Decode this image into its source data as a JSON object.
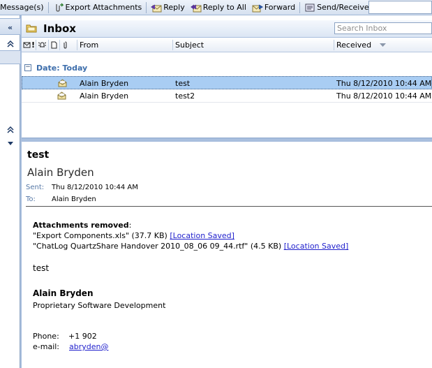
{
  "toolbar": {
    "messages_label": "Message(s)",
    "export_label": "Export Attachments",
    "reply_label": "Reply",
    "reply_all_label": "Reply to All",
    "forward_label": "Forward",
    "send_receive_label": "Send/Receive"
  },
  "rail": {
    "collapse_icon": "double-chevron-left",
    "up_icon_1": "double-chevron-up",
    "up_icon_2": "double-chevron-up",
    "down_icon": "triangle-down"
  },
  "inbox": {
    "title": "Inbox",
    "search_placeholder": "Search Inbox"
  },
  "columns": {
    "from": "From",
    "subject": "Subject",
    "received": "Received"
  },
  "group": {
    "label": "Date: Today"
  },
  "messages": [
    {
      "from": "Alain Bryden",
      "subject": "test",
      "received": "Thu 8/12/2010 10:44 AM",
      "selected": true
    },
    {
      "from": "Alain Bryden",
      "subject": "test2",
      "received": "Thu 8/12/2010 10:44 AM",
      "selected": false
    }
  ],
  "reading_pane": {
    "subject": "test",
    "from": "Alain Bryden",
    "sent_label": "Sent:",
    "sent_value": "Thu 8/12/2010 10:44 AM",
    "to_label": "To:",
    "to_value": "Alain Bryden",
    "attachments_heading": "Attachments removed",
    "attachments_heading_suffix": ":",
    "attachment_1_text": "\"Export Components.xls\" (37.7 KB) ",
    "attachment_1_link": "[Location Saved]",
    "attachment_2_text": "\"ChatLog QuartzShare Handover 2010_08_06 09_44.rtf\" (4.5 KB) ",
    "attachment_2_link": "[Location Saved]",
    "body": "test",
    "sig_name": "Alain Bryden",
    "sig_title": "Proprietary Software Development",
    "phone_label": "Phone:",
    "phone_value": "+1 902",
    "email_label": "e-mail:",
    "email_value": "abryden@"
  },
  "colors": {
    "selection": "#a9cdf3",
    "accent": "#3c6dab",
    "link": "#1f1fcc"
  }
}
